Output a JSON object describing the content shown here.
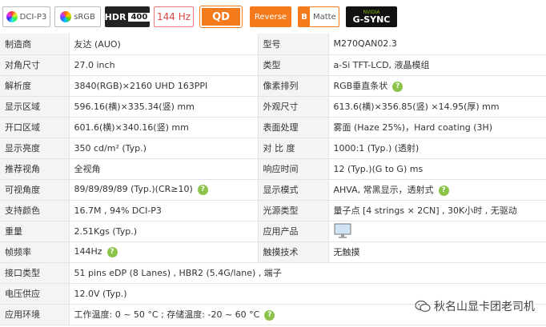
{
  "badges": {
    "dci": "DCI-P3",
    "srgb": "sRGB",
    "hdr": "HDR",
    "hdr_level": "400",
    "hz": "144 Hz",
    "qd": "QD",
    "reverse": "Reverse",
    "matte_b": "B",
    "matte": "Matte",
    "gsync_top": "NVIDIA",
    "gsync": "G-SYNC"
  },
  "specs": [
    {
      "l1": "制造商",
      "v1": "友达 (AUO)",
      "l2": "型号",
      "v2": "M270QAN02.3"
    },
    {
      "l1": "对角尺寸",
      "v1": "27.0 inch",
      "l2": "类型",
      "v2": "a-Si TFT-LCD, 液晶模组"
    },
    {
      "l1": "解析度",
      "v1": "3840(RGB)×2160   UHD   163PPI",
      "l2": "像素排列",
      "v2": "RGB垂直条状",
      "q2": true
    },
    {
      "l1": "显示区域",
      "v1": "596.16(横)×335.34(竖) mm",
      "l2": "外观尺寸",
      "v2": "613.6(横)×356.85(竖) ×14.95(厚) mm"
    },
    {
      "l1": "开口区域",
      "v1": "601.6(横)×340.16(竖) mm",
      "l2": "表面处理",
      "v2": "雾面 (Haze 25%)，Hard coating (3H)"
    },
    {
      "l1": "显示亮度",
      "v1": "350 cd/m² (Typ.)",
      "l2": "对 比 度",
      "v2": "1000:1 (Typ.) (透射)"
    },
    {
      "l1": "推荐视角",
      "v1": "全视角",
      "l2": "响应时间",
      "v2": "12 (Typ.)(G to G) ms"
    },
    {
      "l1": "可视角度",
      "v1": "89/89/89/89 (Typ.)(CR≥10)",
      "q1": true,
      "l2": "显示模式",
      "v2": "AHVA, 常黑显示，透射式",
      "q2": true
    },
    {
      "l1": "支持颜色",
      "v1": "16.7M , 94% DCI-P3",
      "l2": "光源类型",
      "v2": "量子点  [4 strings × 2CN] , 30K小时 , 无驱动"
    },
    {
      "l1": "重量",
      "v1": "2.51Kgs (Typ.)",
      "l2": "应用产品",
      "v2": "",
      "monitor": true
    },
    {
      "l1": "帧频率",
      "v1": "144Hz",
      "q1": true,
      "l2": "触摸技术",
      "v2": "无触摸"
    },
    {
      "l1": "接口类型",
      "v1": "51 pins   eDP (8 Lanes) , HBR2 (5.4G/lane) , 端子",
      "span": true
    },
    {
      "l1": "电压供应",
      "v1": "12.0V (Typ.)",
      "span": true
    },
    {
      "l1": "应用环境",
      "v1": "工作温度: 0 ~ 50 °C ; 存储温度: -20 ~ 60 °C",
      "q1": true,
      "span": true
    }
  ],
  "watermark": "秋名山显卡团老司机"
}
